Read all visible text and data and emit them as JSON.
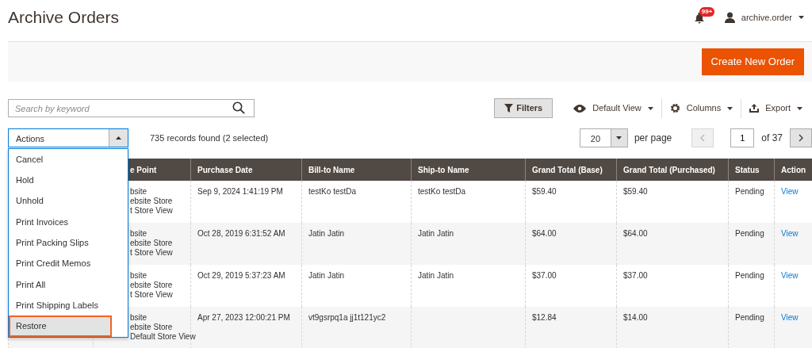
{
  "page_title": "Archive Orders",
  "header": {
    "notifications_badge": "99+",
    "user": "archive.order"
  },
  "primary_button": "Create New Order",
  "search": {
    "placeholder": "Search by keyword"
  },
  "toolbar": {
    "filters": "Filters",
    "view": "Default View",
    "columns": "Columns",
    "export": "Export"
  },
  "actions": {
    "label": "Actions",
    "expanded": true,
    "items": [
      {
        "label": "Cancel",
        "selected": false,
        "highlighted": false
      },
      {
        "label": "Hold",
        "selected": false,
        "highlighted": false
      },
      {
        "label": "Unhold",
        "selected": false,
        "highlighted": false
      },
      {
        "label": "Print Invoices",
        "selected": false,
        "highlighted": false
      },
      {
        "label": "Print Packing Slips",
        "selected": false,
        "highlighted": false
      },
      {
        "label": "Print Credit Memos",
        "selected": false,
        "highlighted": false
      },
      {
        "label": "Print All",
        "selected": false,
        "highlighted": false
      },
      {
        "label": "Print Shipping Labels",
        "selected": false,
        "highlighted": false
      },
      {
        "label": "Restore",
        "selected": true,
        "highlighted": true
      }
    ]
  },
  "records": "735 records found (2 selected)",
  "pager": {
    "per_page_value": "20",
    "per_page_label": "per page",
    "page": "1",
    "total": "of 37",
    "prev_disabled": true
  },
  "table": {
    "columns": [
      "e Point",
      "Purchase Date",
      "Bill-to Name",
      "Ship-to Name",
      "Grand Total (Base)",
      "Grand Total (Purchased)",
      "Status",
      "Action"
    ],
    "rows": [
      {
        "purchase_point": [
          "bsite",
          "ebsite Store",
          "t Store View"
        ],
        "date": "Sep 9, 2024 1:41:19 PM",
        "bill_to": "testKo testDa",
        "ship_to": "testKo testDa",
        "total_base": "$59.40",
        "total_purchased": "$59.40",
        "status": "Pending",
        "action": "View"
      },
      {
        "purchase_point": [
          "bsite",
          "ebsite Store",
          "t Store View"
        ],
        "date": "Oct 28, 2019 6:31:52 AM",
        "bill_to": "Jatin Jatin",
        "ship_to": "Jatin Jatin",
        "total_base": "$64.00",
        "total_purchased": "$64.00",
        "status": "Pending",
        "action": "View"
      },
      {
        "purchase_point": [
          "bsite",
          "ebsite Store",
          "t Store View"
        ],
        "date": "Oct 29, 2019 5:37:23 AM",
        "bill_to": "Jatin Jatin",
        "ship_to": "Jatin Jatin",
        "total_base": "$37.00",
        "total_purchased": "$37.00",
        "status": "Pending",
        "action": "View"
      },
      {
        "purchase_point": [
          "bsite",
          "ebsite Store",
          "Default Store View"
        ],
        "date": "Apr 27, 2023 12:00:21 PM",
        "bill_to": "vt9gsrpq1a jj1t121yc2",
        "total_base": "$12.84",
        "total_purchased": "$14.00",
        "status": "Pending",
        "action": "View"
      }
    ]
  }
}
